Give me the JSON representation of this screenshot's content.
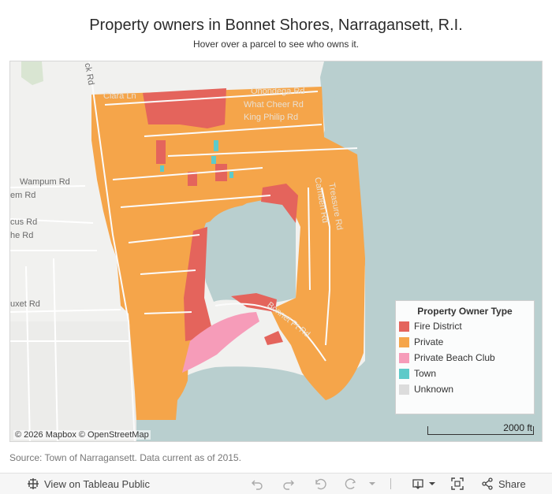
{
  "title": "Property owners in Bonnet Shores, Narragansett, R.I.",
  "subtitle": "Hover over a parcel to see who owns it.",
  "map": {
    "street_labels": [
      {
        "name": "Clara Ln",
        "dark": true
      },
      {
        "name": "Onondega Rd",
        "dark": true
      },
      {
        "name": "What Cheer Rd",
        "dark": true
      },
      {
        "name": "King Philip Rd",
        "dark": true
      },
      {
        "name": "Wampum Rd",
        "dark": false
      },
      {
        "name": "em Rd",
        "dark": false
      },
      {
        "name": "cus Rd",
        "dark": false
      },
      {
        "name": "he Rd",
        "dark": false
      },
      {
        "name": "uxet Rd",
        "dark": false
      },
      {
        "name": "ck Rd",
        "dark": false
      },
      {
        "name": "Bonnet Pt Rd",
        "dark": true
      },
      {
        "name": "Treasure Rd",
        "dark": true
      },
      {
        "name": "Camden Rd",
        "dark": true
      }
    ],
    "credits": "© 2026 Mapbox © OpenStreetMap",
    "scale_label": "2000 ft"
  },
  "legend": {
    "title": "Property Owner Type",
    "items": [
      {
        "label": "Fire District",
        "color": "#e4645c"
      },
      {
        "label": "Private",
        "color": "#f5a54a"
      },
      {
        "label": "Private Beach Club",
        "color": "#f69cb9"
      },
      {
        "label": "Town",
        "color": "#5ecac9"
      },
      {
        "label": "Unknown",
        "color": "#dcdcdc"
      }
    ]
  },
  "source": "Source: Town of Narragansett. Data current as of 2015.",
  "toolbar": {
    "view_label": "View on Tableau Public",
    "share_label": "Share"
  }
}
